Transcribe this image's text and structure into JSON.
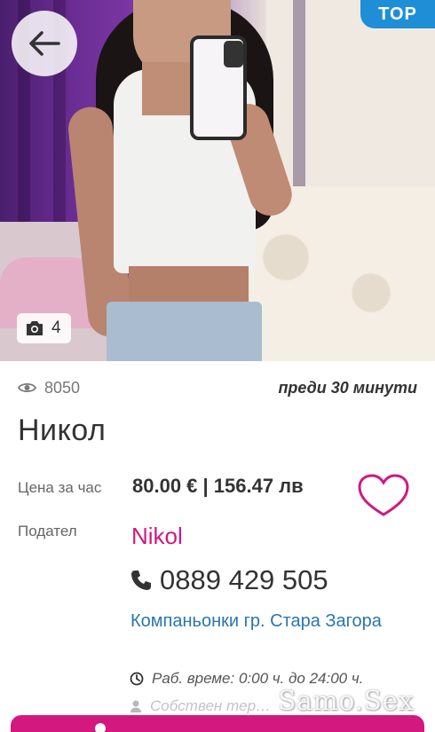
{
  "badge": {
    "label": "TOP"
  },
  "gallery": {
    "photo_count": "4"
  },
  "listing": {
    "views": "8050",
    "posted": "преди 30 минути",
    "name": "Никол"
  },
  "price": {
    "label": "Цена за час",
    "value": "80.00 € | 156.47 лв"
  },
  "poster": {
    "label": "Подател",
    "name": "Nikol"
  },
  "contact": {
    "phone": "0889 429 505"
  },
  "category": {
    "text": "Компаньонки гр. Стара Загора"
  },
  "hours": {
    "text": "Раб. време: 0:00 ч. до 24:00 ч."
  },
  "own_room": {
    "text": "Собствен тер…"
  },
  "watermark": {
    "text": "Samo.Sex"
  },
  "colors": {
    "accent": "#d0197f",
    "link": "#2a76b0",
    "badge": "#1e8fd6"
  },
  "icons": [
    "arrow-left-icon",
    "camera-icon",
    "eye-icon",
    "heart-icon",
    "phone-icon",
    "clock-icon",
    "user-icon"
  ]
}
